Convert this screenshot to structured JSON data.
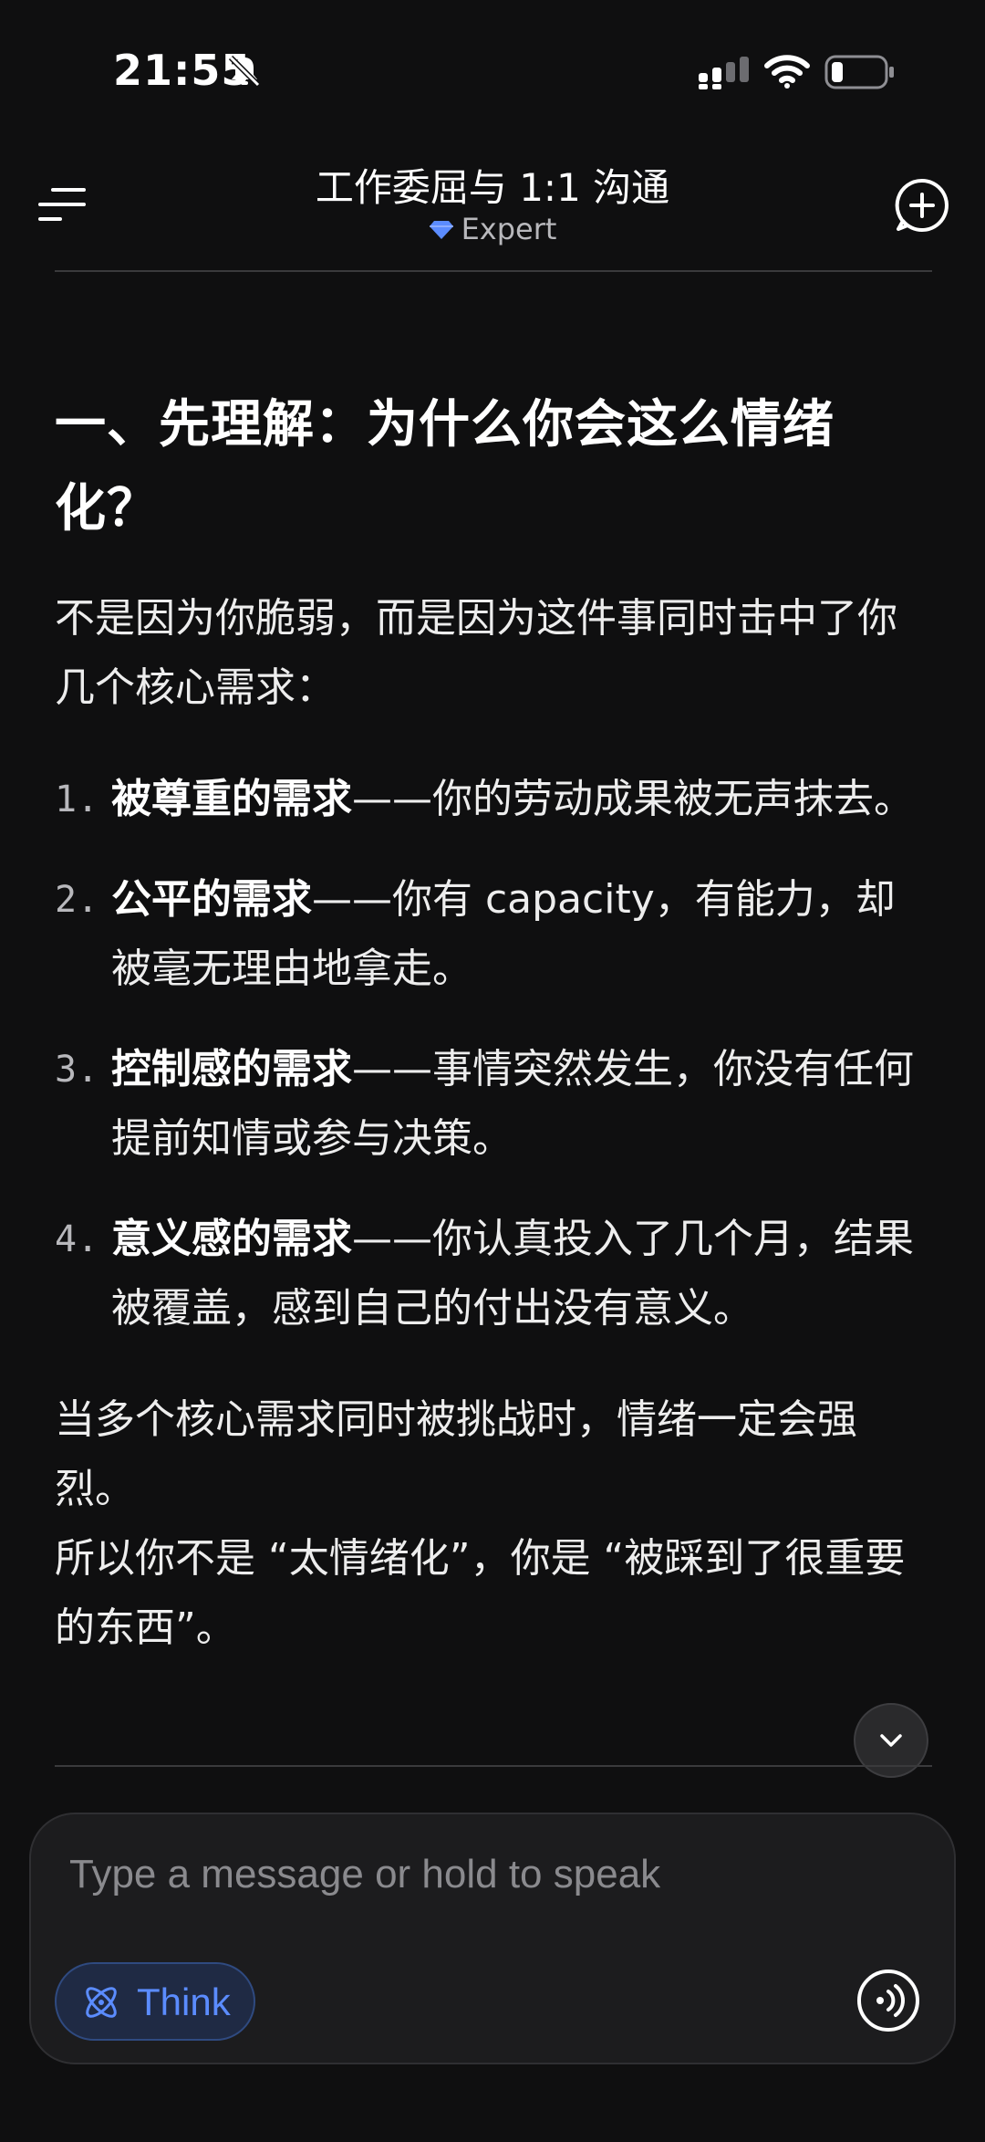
{
  "status_bar": {
    "time": "21:55",
    "icons": [
      "bell-slash-icon",
      "signal-icon",
      "wifi-icon",
      "battery-low-icon"
    ]
  },
  "header": {
    "title": "工作委屈与 1:1 沟通",
    "subtitle": "Expert",
    "left_icon": "menu-icon",
    "right_icon": "new-chat-icon",
    "accent_color": "#5b8cff"
  },
  "content": {
    "heading": "一、先理解：为什么你会这么情绪化？",
    "intro": "不是因为你脆弱，而是因为这件事同时击中了你几个核心需求：",
    "needs": [
      {
        "number": "1.",
        "title": "被尊重的需求",
        "text": "——你的劳动成果被无声抹去。"
      },
      {
        "number": "2.",
        "title": "公平的需求",
        "text": "——你有 capacity，有能力，却被毫无理由地拿走。"
      },
      {
        "number": "3.",
        "title": "控制感的需求",
        "text": "——事情突然发生，你没有任何提前知情或参与决策。"
      },
      {
        "number": "4.",
        "title": "意义感的需求",
        "text": "——你认真投入了几个月，结果被覆盖，感到自己的付出没有意义。"
      }
    ],
    "summary_line1": "当多个核心需求同时被挑战时，情绪一定会强烈。",
    "summary_line2": "所以你不是 “太情绪化”，你是 “被踩到了很重要的东西”。"
  },
  "composer": {
    "placeholder": "Type a message or hold to speak",
    "think_label": "Think",
    "think_color": "#5b8cff"
  }
}
